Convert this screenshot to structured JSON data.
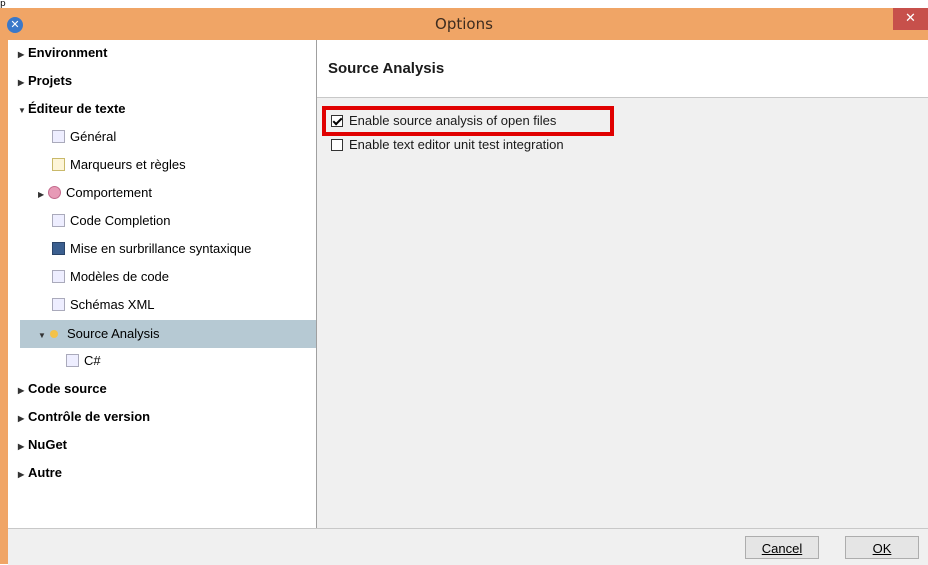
{
  "window": {
    "title": "Options",
    "top_label": "p"
  },
  "sidebar": {
    "items": [
      {
        "label": "Environment",
        "bold": true,
        "expanded": false
      },
      {
        "label": "Projets",
        "bold": true,
        "expanded": false
      },
      {
        "label": "Éditeur de texte",
        "bold": true,
        "expanded": true
      },
      {
        "label": "Général",
        "bold": false
      },
      {
        "label": "Marqueurs et règles",
        "bold": false
      },
      {
        "label": "Comportement",
        "bold": false
      },
      {
        "label": "Code Completion",
        "bold": false
      },
      {
        "label": "Mise en surbrillance syntaxique",
        "bold": false
      },
      {
        "label": "Modèles de code",
        "bold": false
      },
      {
        "label": "Schémas XML",
        "bold": false
      },
      {
        "label": "Source Analysis",
        "bold": false,
        "selected": true
      },
      {
        "label": "C#",
        "bold": false
      },
      {
        "label": "Code source",
        "bold": true,
        "expanded": false
      },
      {
        "label": "Contrôle de version",
        "bold": true,
        "expanded": false
      },
      {
        "label": "NuGet",
        "bold": true,
        "expanded": false
      },
      {
        "label": "Autre",
        "bold": true,
        "expanded": false
      }
    ]
  },
  "panel": {
    "title": "Source Analysis",
    "options": [
      {
        "label": "Enable source analysis of open files",
        "checked": true
      },
      {
        "label": "Enable text editor unit test integration",
        "checked": false
      }
    ]
  },
  "footer": {
    "cancel_label": "Cancel",
    "ok_label": "OK"
  },
  "colors": {
    "titlebar": "#f0a566",
    "close": "#c7504b",
    "selection": "#b6c9d3",
    "highlight": "#e00000"
  }
}
